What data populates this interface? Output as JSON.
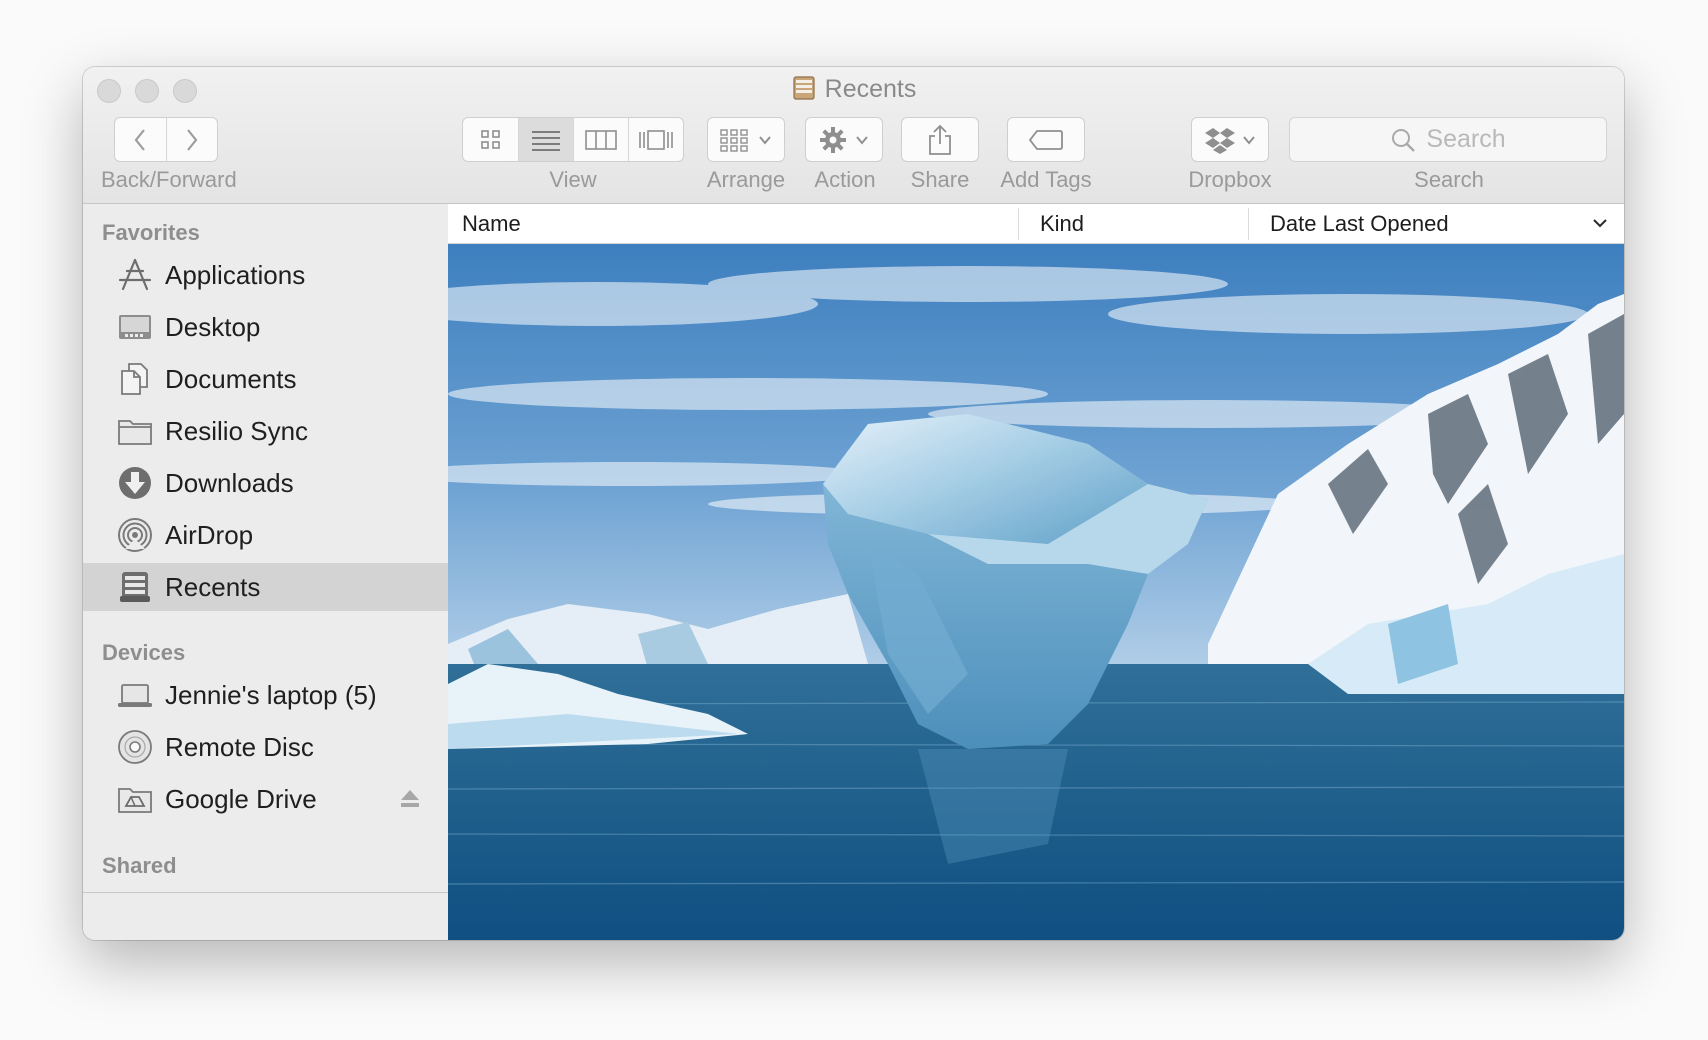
{
  "window": {
    "title": "Recents"
  },
  "toolbar": {
    "back_forward_label": "Back/Forward",
    "view_label": "View",
    "arrange_label": "Arrange",
    "action_label": "Action",
    "share_label": "Share",
    "add_tags_label": "Add Tags",
    "dropbox_label": "Dropbox",
    "search_label": "Search",
    "search_placeholder": "Search",
    "view_modes": [
      "icon-view",
      "list-view",
      "column-view",
      "cover-flow-view"
    ],
    "active_view_mode": "list-view"
  },
  "sidebar": {
    "favorites_heading": "Favorites",
    "favorites": [
      {
        "label": "Applications",
        "icon": "applications-icon"
      },
      {
        "label": "Desktop",
        "icon": "desktop-icon"
      },
      {
        "label": "Documents",
        "icon": "documents-icon"
      },
      {
        "label": "Resilio Sync",
        "icon": "folder-icon"
      },
      {
        "label": "Downloads",
        "icon": "downloads-icon"
      },
      {
        "label": "AirDrop",
        "icon": "airdrop-icon"
      },
      {
        "label": "Recents",
        "icon": "recents-icon",
        "selected": true
      }
    ],
    "devices_heading": "Devices",
    "devices": [
      {
        "label": "Jennie's laptop (5)",
        "icon": "laptop-icon"
      },
      {
        "label": "Remote Disc",
        "icon": "disc-icon"
      },
      {
        "label": "Google Drive",
        "icon": "google-drive-icon",
        "ejectable": true
      }
    ],
    "shared_heading": "Shared"
  },
  "columns": {
    "name": "Name",
    "kind": "Kind",
    "date_last_opened": "Date Last Opened"
  },
  "colors": {
    "sidebar_bg": "#ececec",
    "selected_row_bg": "#d3d3d3",
    "toolbar_text": "#9a9a9a"
  }
}
